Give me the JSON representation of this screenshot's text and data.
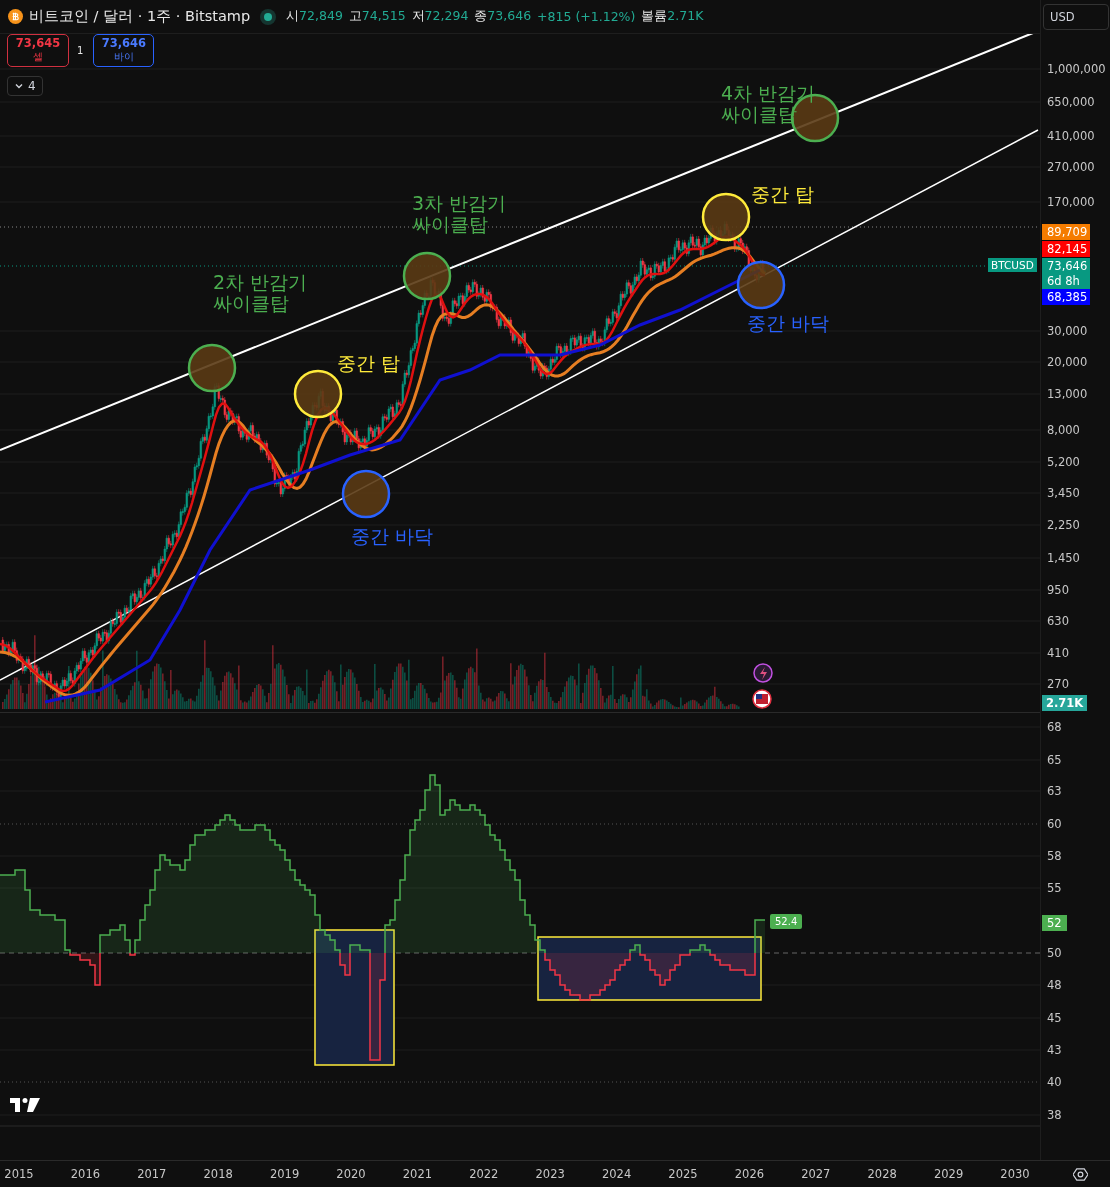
{
  "header": {
    "symbol": "비트코인 / 달러 · 1주 · Bitstamp",
    "ohlc": [
      {
        "label": "시",
        "value": "72,849"
      },
      {
        "label": "고",
        "value": "74,515"
      },
      {
        "label": "저",
        "value": "72,294"
      },
      {
        "label": "종",
        "value": "73,646"
      }
    ],
    "change": "+815 (+1.12%)",
    "volume_label": "볼륨",
    "volume": "2.71K"
  },
  "order_panel": {
    "sell_price": "73,645",
    "sell_label": "셀",
    "spread": "1",
    "buy_price": "73,646",
    "buy_label": "바이"
  },
  "indicators_toggle": {
    "count": "4",
    "expanded": false
  },
  "currency": "USD",
  "price_axis": {
    "ticks": [
      "1,000,000",
      "650,000",
      "410,000",
      "270,000",
      "170,000",
      "30,000",
      "20,000",
      "13,000",
      "8,000",
      "5,200",
      "3,450",
      "2,250",
      "1,450",
      "950",
      "630",
      "410",
      "270"
    ]
  },
  "symbol_tag": "BTCUSD",
  "price_labels": [
    {
      "text": "89,709",
      "color": "#f57c00"
    },
    {
      "text": "82,145",
      "color": "#ff0000"
    },
    {
      "text": "73,646",
      "countdown": "6d 8h",
      "color": "#089981"
    },
    {
      "text": "68,385",
      "color": "#0000ff"
    }
  ],
  "volume_tag": "2.71K",
  "annotations": [
    {
      "kind": "label",
      "text": "2차 반감기\n싸이클탑",
      "color": "#4caf50"
    },
    {
      "kind": "label",
      "text": "3차 반감기\n싸이클탑",
      "color": "#4caf50"
    },
    {
      "kind": "label",
      "text": "4차 반감기\n싸이클탑",
      "color": "#4caf50"
    },
    {
      "kind": "label",
      "text": "중간 탑",
      "color": "#ffeb3b"
    },
    {
      "kind": "label",
      "text": "중간 탑",
      "color": "#ffeb3b"
    },
    {
      "kind": "label",
      "text": "중간 바닥",
      "color": "#2962ff"
    },
    {
      "kind": "label",
      "text": "중간 바닥",
      "color": "#2962ff"
    },
    {
      "kind": "circle",
      "color": "#4caf50"
    },
    {
      "kind": "circle",
      "color": "#4caf50"
    },
    {
      "kind": "circle",
      "color": "#4caf50"
    },
    {
      "kind": "circle",
      "color": "#ffeb3b"
    },
    {
      "kind": "circle",
      "color": "#ffeb3b"
    },
    {
      "kind": "circle",
      "color": "#2962ff"
    },
    {
      "kind": "circle",
      "color": "#2962ff"
    }
  ],
  "rsi_axis": {
    "ticks": [
      "68",
      "65",
      "63",
      "60",
      "58",
      "55",
      "50",
      "48",
      "45",
      "43",
      "40",
      "38"
    ]
  },
  "rsi_tag": "52",
  "rsi_value": "52.4",
  "time_axis": {
    "ticks": [
      "2015",
      "2016",
      "2017",
      "2018",
      "2019",
      "2020",
      "2021",
      "2022",
      "2023",
      "2024",
      "2025",
      "2026",
      "2027",
      "2028",
      "2029",
      "2030"
    ]
  }
}
